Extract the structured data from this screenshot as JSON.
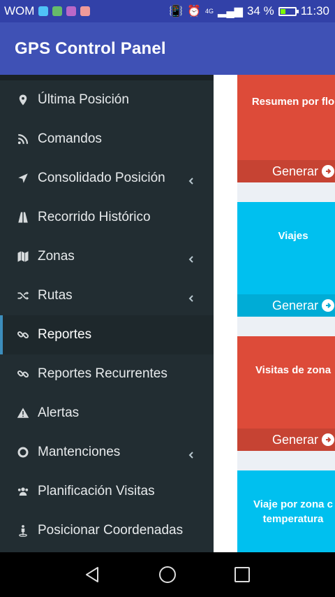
{
  "status_bar": {
    "carrier": "WOM",
    "network": "4G",
    "battery_text": "34 %",
    "battery_level": 0.34,
    "time": "11:30"
  },
  "app_bar": {
    "title": "GPS Control Panel"
  },
  "sidebar": {
    "items": [
      {
        "label": "Última Posición",
        "icon": "map-marker-icon",
        "has_submenu": false
      },
      {
        "label": "Comandos",
        "icon": "rss-icon",
        "has_submenu": false
      },
      {
        "label": "Consolidado Posición",
        "icon": "location-arrow-icon",
        "has_submenu": true
      },
      {
        "label": "Recorrido Histórico",
        "icon": "road-icon",
        "has_submenu": false
      },
      {
        "label": "Zonas",
        "icon": "map-icon",
        "has_submenu": true
      },
      {
        "label": "Rutas",
        "icon": "random-icon",
        "has_submenu": true
      },
      {
        "label": "Reportes",
        "icon": "link-icon",
        "has_submenu": false,
        "active": true
      },
      {
        "label": "Reportes Recurrentes",
        "icon": "link-icon",
        "has_submenu": false
      },
      {
        "label": "Alertas",
        "icon": "warning-icon",
        "has_submenu": false
      },
      {
        "label": "Mantenciones",
        "icon": "life-ring-icon",
        "has_submenu": true
      },
      {
        "label": "Planificación Visitas",
        "icon": "users-icon",
        "has_submenu": false
      },
      {
        "label": "Posicionar Coordenadas",
        "icon": "street-view-icon",
        "has_submenu": false
      }
    ]
  },
  "report_cards": [
    {
      "title": "Resumen por flo",
      "action": "Generar",
      "color": "#dd4b39"
    },
    {
      "title": "Viajes",
      "action": "Generar",
      "color": "#00c0ef"
    },
    {
      "title": "Visitas de zona",
      "action": "Generar",
      "color": "#dd4b39"
    },
    {
      "title_line1": "Viaje por zona c",
      "title_line2": "temperatura",
      "color": "#00c0ef"
    }
  ]
}
